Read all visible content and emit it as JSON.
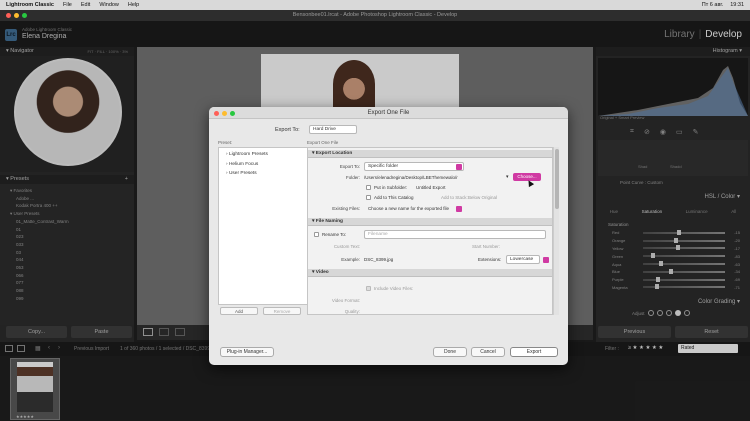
{
  "menubar": {
    "app": "Lightroom Classic",
    "items": [
      "File",
      "Edit",
      "Window",
      "Help"
    ],
    "right": [
      "Пт 6 авг.",
      "19:31"
    ]
  },
  "window": {
    "title": "Bensonbee01.lrcat - Adobe Photoshop Lightroom Classic - Develop"
  },
  "identity": {
    "logo": "Lrc",
    "subtitle": "Adobe Lightroom Classic",
    "user": "Elena Dregina",
    "modules": [
      "Library",
      "Develop"
    ],
    "active_module": "Develop"
  },
  "left": {
    "navigator_label": "Navigator",
    "nav_zoom": [
      "FIT",
      "FILL",
      "100%",
      "3%"
    ],
    "presets_label": "Presets",
    "preset_groups": [
      "Favorites",
      "Adobe ...",
      "Kodak Portra 400 ++",
      "User Presets"
    ],
    "user_presets": [
      "01_Matte_Contrast_Warm",
      "01",
      "023",
      "033",
      "03",
      "044",
      "053",
      "066",
      "077",
      "088",
      "099"
    ],
    "copy_label": "Copy...",
    "paste_label": "Paste"
  },
  "right": {
    "histogram_label": "Histogram",
    "original_photo": "Original + Smart Preview",
    "hsl_label": "HSL / Color",
    "hsl_tabs": [
      "Hue",
      "Saturation",
      "Luminance",
      "All"
    ],
    "section_saturation": "Saturation",
    "sliders": [
      {
        "label": "Red",
        "value": "-15",
        "pos": 0.42
      },
      {
        "label": "Orange",
        "value": "-20",
        "pos": 0.38
      },
      {
        "label": "Yellow",
        "value": "-17",
        "pos": 0.4
      },
      {
        "label": "Green",
        "value": "-83",
        "pos": 0.1
      },
      {
        "label": "Aqua",
        "value": "-63",
        "pos": 0.2
      },
      {
        "label": "Blue",
        "value": "-34",
        "pos": 0.32
      },
      {
        "label": "Purple",
        "value": "-69",
        "pos": 0.16
      },
      {
        "label": "Magenta",
        "value": "-71",
        "pos": 0.15
      }
    ],
    "point_curve_label": "Point Curve :",
    "point_curve_value": "Custom",
    "curve_labels": [
      "Shad",
      "Shadd"
    ],
    "color_grading_label": "Color Grading",
    "adjust_label": "Adjust",
    "previous_label": "Previous",
    "reset_label": "Reset"
  },
  "filmstrip": {
    "left_info": "Previous Import",
    "count_info": "1 of 360 photos / 1 selected / DSC_8399",
    "filter_label": "Filter :",
    "rated_label": "Rated",
    "rating": "★★★★★"
  },
  "dialog": {
    "title": "Export One File",
    "export_to_label": "Export To:",
    "export_to_value": "Hard Drive",
    "preset_label": "Preset:",
    "presets": [
      "Lightroom Presets",
      "Helium Focus",
      "User Presets"
    ],
    "add_label": "Add",
    "remove_label": "Remove",
    "settings_label": "Export One File",
    "sections": {
      "export_location": "Export Location",
      "file_naming": "File Naming",
      "video": "Video"
    },
    "export_to_field_label": "Export To:",
    "export_to_field_value": "Specific folder",
    "folder_label": "Folder:",
    "folder_value": "/Users/elenadregina/Desktop/LBEThemewalo/r",
    "choose_label": "Choose...",
    "put_in_subfolder": "Put in Subfolder:",
    "subfolder_value": "Untitled Export",
    "add_to_catalog": "Add to This Catalog",
    "add_to_stack": "Add to Stack:",
    "below_original": "Below Original",
    "existing_files_label": "Existing Files:",
    "existing_files_value": "Choose a new name for the exported file",
    "rename_to": "Rename To:",
    "rename_value": "Filename",
    "custom_text": "Custom Text:",
    "start_number": "Start Number:",
    "example_label": "Example:",
    "example_value": "DSC_8399.jpg",
    "extensions_label": "Extensions:",
    "extensions_value": "Lowercase",
    "include_video": "Include Video Files:",
    "video_format": "Video Format:",
    "quality": "Quality:",
    "plugin_manager": "Plug-in Manager...",
    "done": "Done",
    "cancel": "Cancel",
    "export": "Export"
  },
  "colors": {
    "accent": "#d03aa3",
    "close": "#ff5f57",
    "minimize": "#febc2e",
    "zoom": "#28c840"
  }
}
